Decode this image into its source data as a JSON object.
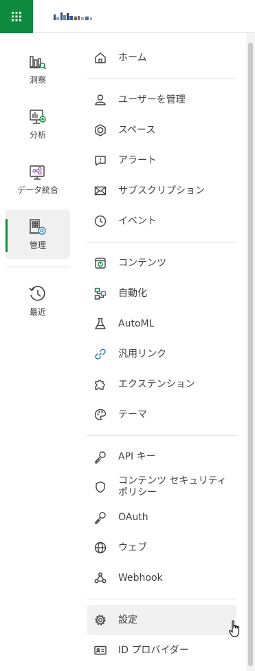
{
  "colors": {
    "brand": "#0d8a3e",
    "active_bg": "#f0f0f0",
    "icon": "#404040"
  },
  "topbar": {
    "apps_icon": "grid-icon",
    "logo": "qlik-logo"
  },
  "rail": {
    "items": [
      {
        "label": "洞察",
        "icon": "insights-icon",
        "active": false
      },
      {
        "label": "分析",
        "icon": "analytics-icon",
        "active": false
      },
      {
        "label": "データ統合",
        "icon": "data-integration-icon",
        "active": false
      },
      {
        "label": "管理",
        "icon": "admin-icon",
        "active": true
      },
      {
        "label": "最近",
        "icon": "clock-icon",
        "active": false
      }
    ]
  },
  "menu": {
    "items": [
      {
        "label": "ホーム",
        "icon": "home-icon"
      },
      {
        "label": "ユーザーを管理",
        "icon": "user-icon"
      },
      {
        "label": "スペース",
        "icon": "space-icon"
      },
      {
        "label": "アラート",
        "icon": "alert-icon"
      },
      {
        "label": "サブスクリプション",
        "icon": "mail-icon"
      },
      {
        "label": "イベント",
        "icon": "clock-icon"
      },
      {
        "label": "コンテンツ",
        "icon": "content-icon"
      },
      {
        "label": "自動化",
        "icon": "automation-icon"
      },
      {
        "label": "AutoML",
        "icon": "flask-icon"
      },
      {
        "label": "汎用リンク",
        "icon": "link-icon"
      },
      {
        "label": "エクステンション",
        "icon": "puzzle-icon"
      },
      {
        "label": "テーマ",
        "icon": "palette-icon"
      },
      {
        "label": "API キー",
        "icon": "key-icon"
      },
      {
        "label": "コンテンツ セキュリティ ポリシー",
        "icon": "shield-icon"
      },
      {
        "label": "OAuth",
        "icon": "key-icon"
      },
      {
        "label": "ウェブ",
        "icon": "globe-icon"
      },
      {
        "label": "Webhook",
        "icon": "webhook-icon"
      },
      {
        "label": "設定",
        "icon": "gear-icon",
        "hovered": true
      },
      {
        "label": "ID プロバイダー",
        "icon": "id-card-icon"
      }
    ]
  }
}
